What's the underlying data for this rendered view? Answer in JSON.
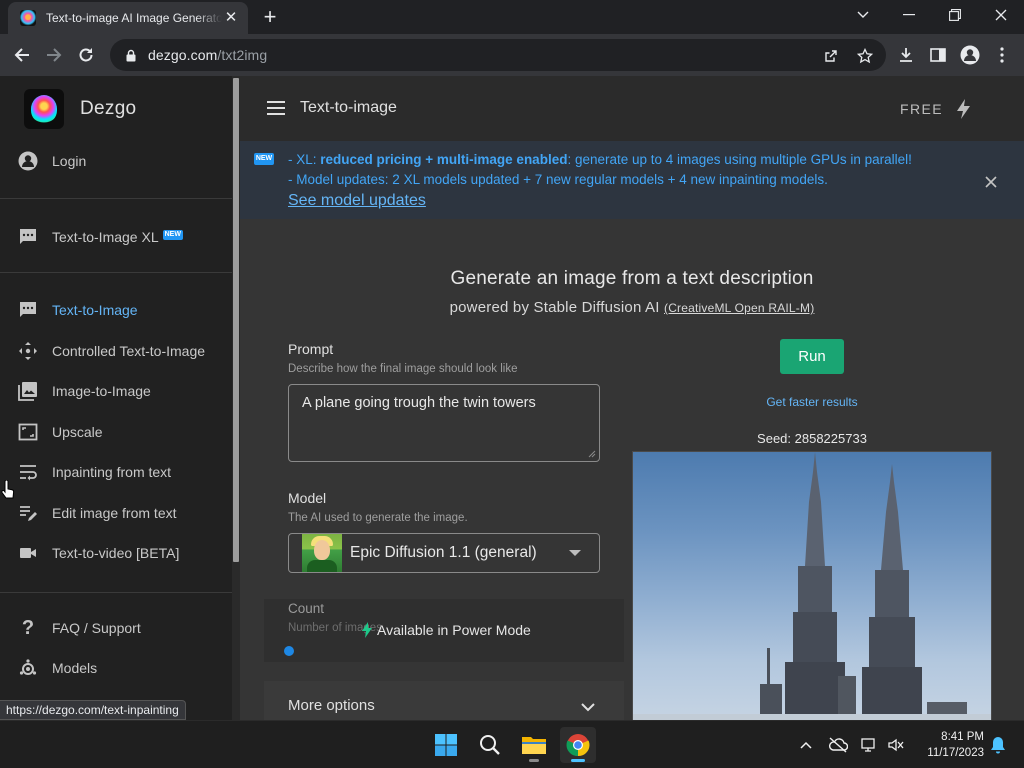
{
  "browser": {
    "tab_title": "Text-to-image AI Image Generator",
    "tab_close": "✕",
    "new_tab": "+",
    "url_host": "dezgo.com",
    "url_path": "/txt2img",
    "status_url": "https://dezgo.com/text-inpainting"
  },
  "sidebar": {
    "brand": "Dezgo",
    "login": "Login",
    "new_badge": "NEW",
    "xl_item": "Text-to-Image XL",
    "items": [
      {
        "label": "Text-to-Image",
        "icon": "chat-icon"
      },
      {
        "label": "Controlled Text-to-Image",
        "icon": "move-icon"
      },
      {
        "label": "Image-to-Image",
        "icon": "image-icon"
      },
      {
        "label": "Upscale",
        "icon": "upscale-icon"
      },
      {
        "label": "Inpainting from text",
        "icon": "wrap-text-icon"
      },
      {
        "label": "Edit image from text",
        "icon": "edit-note-icon"
      },
      {
        "label": "Text-to-video [BETA]",
        "icon": "videocam-icon"
      }
    ],
    "faq": "FAQ / Support",
    "models": "Models"
  },
  "appbar": {
    "title": "Text-to-image",
    "free": "FREE"
  },
  "banner": {
    "badge": "NEW",
    "line1_prefix": "- XL: ",
    "line1_bold": "reduced pricing + multi-image enabled",
    "line1_rest": ": generate up to 4 images using multiple GPUs in parallel!",
    "line2": "- Model updates: 2 XL models updated + 7 new regular models + 4 new inpainting models.",
    "link": "See model updates"
  },
  "main": {
    "heading": "Generate an image from a text description",
    "subheading": "powered by Stable Diffusion AI",
    "license": "(CreativeML Open RAIL-M)",
    "prompt_label": "Prompt",
    "prompt_hint": "Describe how the final image should look like",
    "prompt_value": "A plane going trough the twin towers",
    "model_label": "Model",
    "model_hint": "The AI used to generate the image.",
    "model_value": "Epic Diffusion 1.1 (general)",
    "count_label": "Count",
    "count_hint": "Number of images",
    "power_mode": "Available in Power Mode",
    "more_options": "More options",
    "run": "Run",
    "faster": "Get faster results",
    "seed": "Seed: 2858225733"
  },
  "taskbar": {
    "time": "8:41 PM",
    "date": "11/17/2023"
  },
  "colors": {
    "accent": "#1aa573",
    "link": "#64b5f6",
    "banner_text": "#42a5f5"
  }
}
